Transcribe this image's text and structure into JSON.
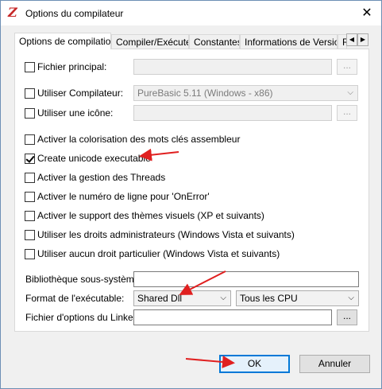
{
  "window": {
    "title": "Options du compilateur",
    "app_icon": "purebasic-icon",
    "close_icon": "close-icon"
  },
  "tabs": [
    {
      "label": "Options de compilation",
      "active": true
    },
    {
      "label": "Compiler/Exécuter",
      "active": false
    },
    {
      "label": "Constantes",
      "active": false
    },
    {
      "label": "Informations de Version",
      "active": false
    },
    {
      "label": "R",
      "active": false
    }
  ],
  "tab_scroll": {
    "left": "◀",
    "right": "▶"
  },
  "fields": {
    "main_file": {
      "label": "Fichier principal:",
      "value": "",
      "browse": "...",
      "checked": false
    },
    "compiler": {
      "label": "Utiliser Compilateur:",
      "value": "PureBasic 5.11 (Windows - x86)",
      "checked": false
    },
    "icon": {
      "label": "Utiliser une icône:",
      "value": "",
      "browse": "...",
      "checked": false
    }
  },
  "options": [
    {
      "label": "Activer la colorisation des mots clés assembleur",
      "checked": false
    },
    {
      "label": "Create unicode executable",
      "checked": true
    },
    {
      "label": "Activer la gestion des Threads",
      "checked": false
    },
    {
      "label": "Activer le numéro de ligne pour 'OnError'",
      "checked": false
    },
    {
      "label": "Activer le support des thèmes visuels (XP et suivants)",
      "checked": false
    },
    {
      "label": "Utiliser les droits administrateurs (Windows Vista et suivants)",
      "checked": false
    },
    {
      "label": "Utiliser aucun droit particulier (Windows Vista et suivants)",
      "checked": false
    }
  ],
  "subsystem": {
    "label": "Bibliothèque sous-système:",
    "value": ""
  },
  "format": {
    "label": "Format de l'exécutable:",
    "value": "Shared Dll",
    "cpu_value": "Tous les CPU"
  },
  "linker": {
    "label": "Fichier d'options du Linker:",
    "value": "",
    "browse": "..."
  },
  "buttons": {
    "ok": "OK",
    "cancel": "Annuler"
  },
  "colors": {
    "annotation_arrow": "#e02020",
    "default_button_border": "#0078d7"
  }
}
